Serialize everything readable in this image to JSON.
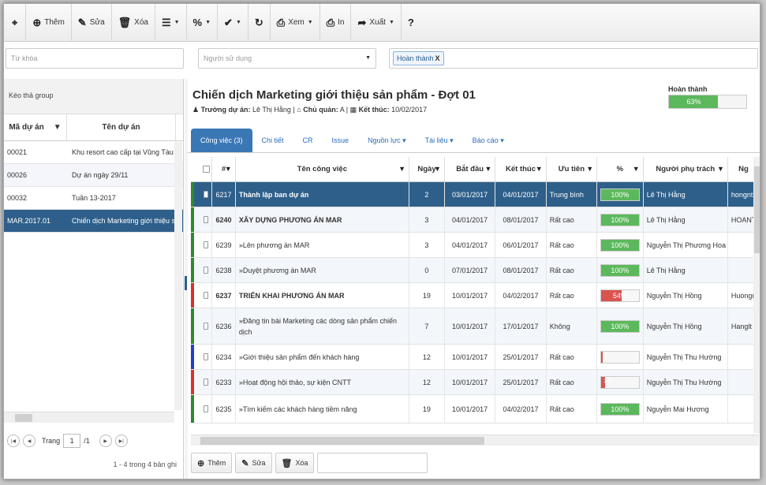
{
  "toolbar": {
    "find_icon": "binoculars-icon",
    "add": "Thêm",
    "edit": "Sửa",
    "delete": "Xóa",
    "view": "Xem",
    "print": "In",
    "export": "Xuất"
  },
  "filters": {
    "keyword_placeholder": "Từ khóa",
    "user_placeholder": "Người sử dụng",
    "status_tag": "Hoàn thành"
  },
  "left_panel": {
    "group_hint": "Kéo thả group",
    "columns": [
      "Mã dự án",
      "Tên dự án"
    ],
    "rows": [
      {
        "code": "00021",
        "name": "Khu resort cao cấp tại Vũng Tàu"
      },
      {
        "code": "00026",
        "name": "Dự án ngày 29/11"
      },
      {
        "code": "00032",
        "name": "Tuần 13-2017"
      },
      {
        "code": "MAR.2017.01",
        "name": "Chiến dịch Marketing giới thiệu sản phẩm"
      }
    ],
    "pager": {
      "label": "Trang",
      "page": "1",
      "total": "/1",
      "summary": "1 - 4 trong 4 bản ghi"
    }
  },
  "project": {
    "title": "Chiến dịch Marketing giới thiệu sản phẩm - Đợt 01",
    "manager_label": "Trưởng dự án:",
    "manager": "Lê Thị Hằng",
    "owner_label": "Chủ quản:",
    "owner": "A",
    "end_label": "Kết thúc:",
    "end": "10/02/2017",
    "status_label": "Hoàn thành",
    "progress": 63,
    "progress_text": "63%"
  },
  "tabs": [
    "Công việc (3)",
    "Chi tiết",
    "CR",
    "Issue",
    "Nguồn lực ▾",
    "Tài liệu ▾",
    "Báo cáo ▾"
  ],
  "grid": {
    "columns": [
      "#",
      "Tên công việc",
      "Ngày",
      "Bắt đầu",
      "Kết thúc",
      "Ưu tiên",
      "%",
      "Người phụ trách",
      "Ng"
    ],
    "rows": [
      {
        "id": "6217",
        "name": "Thành lập ban dự án",
        "days": "2",
        "start": "03/01/2017",
        "end": "04/01/2017",
        "priority": "Trung bình",
        "pct": 100,
        "pct_text": "100%",
        "owner": "Lê Thị Hằng",
        "extra": "hongnt;",
        "stripe": "#2d8a2d",
        "bold": false
      },
      {
        "id": "6240",
        "name": "XÂY DỰNG PHƯƠNG ÁN MAR",
        "days": "3",
        "start": "04/01/2017",
        "end": "08/01/2017",
        "priority": "Rất cao",
        "pct": 100,
        "pct_text": "100%",
        "owner": "Lê Thị Hằng",
        "extra": "HOANT",
        "stripe": "#2d8a2d",
        "bold": true
      },
      {
        "id": "6239",
        "name": "»Lên phương án MAR",
        "days": "3",
        "start": "04/01/2017",
        "end": "06/01/2017",
        "priority": "Rất cao",
        "pct": 100,
        "pct_text": "100%",
        "owner": "Nguyễn Thị Phương Hoa",
        "extra": "",
        "stripe": "#2d8a2d",
        "bold": false
      },
      {
        "id": "6238",
        "name": "»Duyệt phương án MAR",
        "days": "0",
        "start": "07/01/2017",
        "end": "08/01/2017",
        "priority": "Rất cao",
        "pct": 100,
        "pct_text": "100%",
        "owner": "Lê Thị Hằng",
        "extra": "",
        "stripe": "#2d8a2d",
        "bold": false
      },
      {
        "id": "6237",
        "name": "TRIỂN KHAI PHƯƠNG ÁN MAR",
        "days": "19",
        "start": "10/01/2017",
        "end": "04/02/2017",
        "priority": "Rất cao",
        "pct": 54,
        "pct_text": "54%",
        "owner": "Nguyễn Thị Hồng",
        "extra": "Huongn",
        "stripe": "#d9302c",
        "bold": true
      },
      {
        "id": "6236",
        "name": "»Đăng tin bài Marketing các dòng sản phẩm chiến dịch",
        "days": "7",
        "start": "10/01/2017",
        "end": "17/01/2017",
        "priority": "Không",
        "pct": 100,
        "pct_text": "100%",
        "owner": "Nguyễn Thị Hồng",
        "extra": "Hanglt",
        "stripe": "#2d8a2d",
        "bold": false
      },
      {
        "id": "6234",
        "name": "»Giới thiệu sản phẩm đến khách hàng",
        "days": "12",
        "start": "10/01/2017",
        "end": "25/01/2017",
        "priority": "Rất cao",
        "pct": 3,
        "pct_text": "3",
        "owner": "Nguyễn Thị Thu Hường",
        "extra": "",
        "stripe": "#1f3fd0",
        "bold": false
      },
      {
        "id": "6233",
        "name": "»Hoạt động hội thảo, sự kiện CNTT",
        "days": "12",
        "start": "10/01/2017",
        "end": "25/01/2017",
        "priority": "Rất cao",
        "pct": 10,
        "pct_text": "10",
        "owner": "Nguyễn Thị Thu Hường",
        "extra": "",
        "stripe": "#d9302c",
        "bold": false
      },
      {
        "id": "6235",
        "name": "»Tìm kiếm các khách hàng tiềm năng",
        "days": "19",
        "start": "10/01/2017",
        "end": "04/02/2017",
        "priority": "Rất cao",
        "pct": 100,
        "pct_text": "100%",
        "owner": "Nguyễn Mai Hương",
        "extra": "",
        "stripe": "#2d8a2d",
        "bold": false
      }
    ]
  },
  "bottom": {
    "add": "Thêm",
    "edit": "Sửa",
    "delete": "Xóa"
  },
  "colors": {
    "accent": "#3a77b5",
    "selected": "#2e5f8a",
    "success": "#5cb85c",
    "danger": "#d9534f"
  }
}
